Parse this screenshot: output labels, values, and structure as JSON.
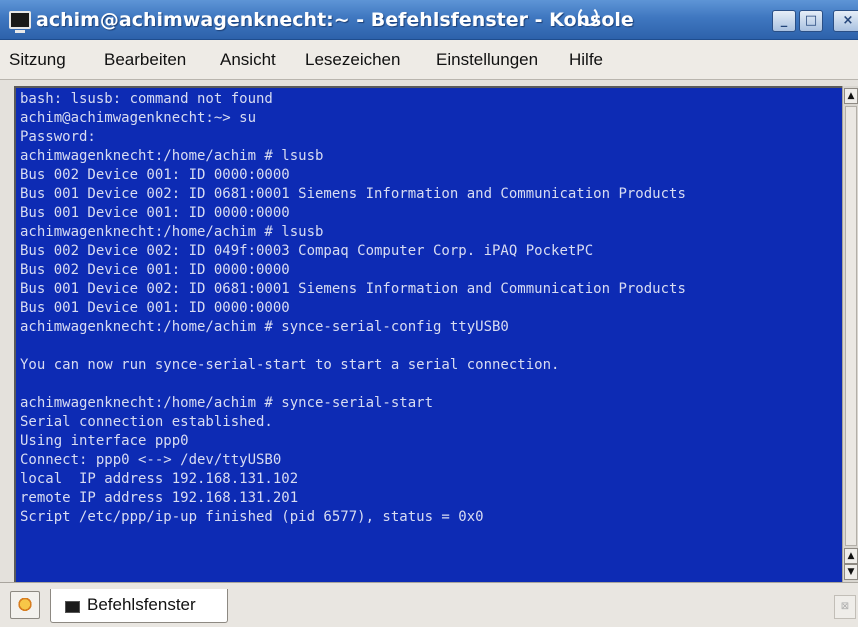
{
  "window": {
    "title": "achim@achimwagenknecht:~ - Befehlsfenster - Konsole",
    "icons": {
      "app": "terminal-icon",
      "title_glyph": "bell-icon",
      "minimize": "minimize-icon",
      "maximize": "maximize-icon",
      "close": "close-icon"
    },
    "accent": "#3f77c0"
  },
  "menubar": {
    "items": [
      "Sitzung",
      "Bearbeiten",
      "Ansicht",
      "Lesezeichen",
      "Einstellungen",
      "Hilfe"
    ]
  },
  "terminal": {
    "background": "#0d2bb4",
    "foreground": "#d8dcf2",
    "lines": [
      "bash: lsusb: command not found",
      "achim@achimwagenknecht:~> su",
      "Password:",
      "achimwagenknecht:/home/achim # lsusb",
      "Bus 002 Device 001: ID 0000:0000",
      "Bus 001 Device 002: ID 0681:0001 Siemens Information and Communication Products",
      "Bus 001 Device 001: ID 0000:0000",
      "achimwagenknecht:/home/achim # lsusb",
      "Bus 002 Device 002: ID 049f:0003 Compaq Computer Corp. iPAQ PocketPC",
      "Bus 002 Device 001: ID 0000:0000",
      "Bus 001 Device 002: ID 0681:0001 Siemens Information and Communication Products",
      "Bus 001 Device 001: ID 0000:0000",
      "achimwagenknecht:/home/achim # synce-serial-config ttyUSB0",
      "",
      "You can now run synce-serial-start to start a serial connection.",
      "",
      "achimwagenknecht:/home/achim # synce-serial-start",
      "Serial connection established.",
      "Using interface ppp0",
      "Connect: ppp0 <--> /dev/ttyUSB0",
      "local  IP address 192.168.131.102",
      "remote IP address 192.168.131.201",
      "Script /etc/ppp/ip-up finished (pid 6577), status = 0x0"
    ]
  },
  "scrollbar": {
    "up_icon": "arrow-up-icon",
    "down_icon": "arrow-down-icon"
  },
  "tabbar": {
    "new_tab_icon": "new-session-icon",
    "tabs": [
      {
        "label": "Befehlsfenster",
        "icon": "terminal-icon"
      }
    ],
    "close_icon": "close-tab-icon"
  }
}
